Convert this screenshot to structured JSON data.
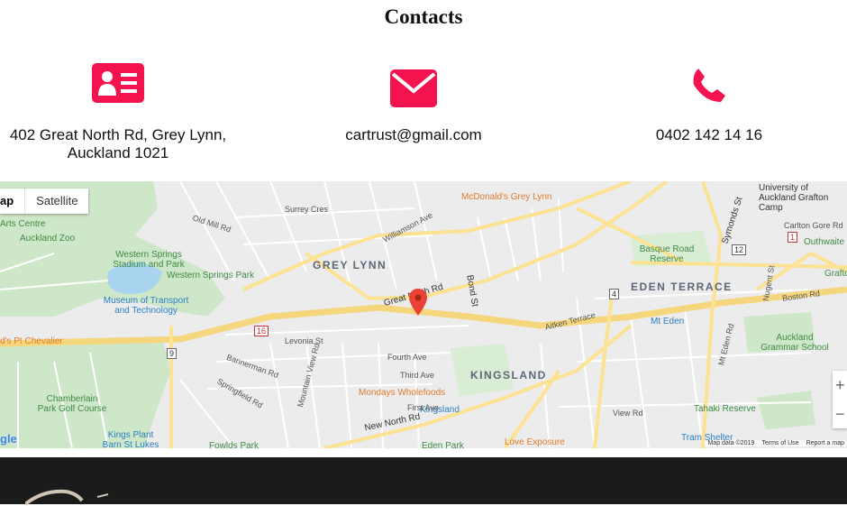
{
  "title": "Contacts",
  "contacts": [
    {
      "icon": "address-card-icon",
      "text": "402 Great North Rd, Grey Lynn, Auckland 1021"
    },
    {
      "icon": "envelope-icon",
      "text": "cartrust@gmail.com"
    },
    {
      "icon": "phone-icon",
      "text": "0402 142 14 16"
    }
  ],
  "map": {
    "type_tabs": [
      "ap",
      "Satellite"
    ],
    "zoom_in": "+",
    "zoom_out": "−",
    "google_logo": "gle",
    "attribution": [
      "Map data ©2019",
      "Terms of Use",
      "Report a map"
    ],
    "labels": {
      "grey_lynn": "GREY LYNN",
      "eden_terrace": "EDEN TERRACE",
      "kingsland": "KINGSLAND",
      "great_north_rd": "Great North Rd",
      "western_springs_stadium": "Western Springs Stadium and Park",
      "western_springs_park": "Western Springs Park",
      "auckland_zoo": "Auckland Zoo",
      "motat": "Museum of Transport and Technology",
      "mcdonalds": "McDonald's Grey Lynn",
      "basque_road_reserve": "Basque Road Reserve",
      "mt_eden": "Mt Eden",
      "auckland_grammar": "Auckland Grammar School",
      "mondays_wholefoods": "Mondays Wholefoods",
      "kingsland_station": "Kingsland",
      "chamberlain_park": "Chamberlain Park Golf Course",
      "kings_plant_barn": "Kings Plant Barn St Lukes",
      "tahaki_reserve": "Tahaki Reserve",
      "love_exposure": "Love Exposure",
      "eden_park": "Eden Park",
      "fowlds_park": "Fowlds Park",
      "university": "University of Auckland Grafton Camp",
      "outhwaite": "Outhwaite",
      "pt_chevalier": "d's Pt Chevalier",
      "arts_centre": "Arts Centre",
      "new_north_rd": "New North Rd",
      "tram_shelter": "Tram Shelter",
      "graftc": "Graftc",
      "old_mill_rd": "Old Mill Rd",
      "surrey_cres": "Surrey Cres",
      "williamson_ave": "Williamson Ave",
      "bond_st": "Bond St",
      "symonds_st": "Symonds St",
      "view_rd": "View Rd",
      "boston_rd": "Boston Rd",
      "nugent_st": "Nugent St",
      "fourth_ave": "Fourth Ave",
      "third_ave": "Third Ave",
      "first_ave": "First Ave",
      "aitken_terrace": "Aitken Terrace",
      "levonia_st": "Levonia St",
      "springfield_rd": "Springfield Rd",
      "bannerman_rd": "Bannerman Rd",
      "mountain_view_rd": "Mountain View Rd",
      "carlton_gore_rd": "Carlton Gore Rd",
      "mt_eden_rd": "Mt Eden Rd",
      "route_16": "16",
      "route_9": "9",
      "route_4": "4",
      "route_12": "12",
      "route_1": "1"
    }
  }
}
